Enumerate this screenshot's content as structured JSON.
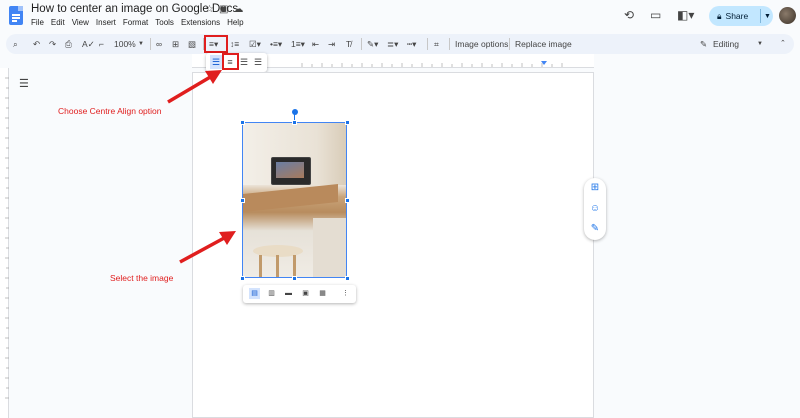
{
  "header": {
    "doc_title": "How to center an image on Google Docs",
    "menu": [
      "File",
      "Edit",
      "View",
      "Insert",
      "Format",
      "Tools",
      "Extensions",
      "Help"
    ],
    "share_label": "Share"
  },
  "toolbar": {
    "zoom": "100%",
    "image_options": "Image options",
    "replace_image": "Replace image",
    "editing": "Editing"
  },
  "annotations": {
    "align_note": "Choose Centre Align option",
    "image_note": "Select the image"
  },
  "colors": {
    "annotation_red": "#e01e1e",
    "selection_blue": "#1a73e8",
    "share_bg": "#c2e7ff",
    "toolbar_bg": "#edf2fa"
  }
}
